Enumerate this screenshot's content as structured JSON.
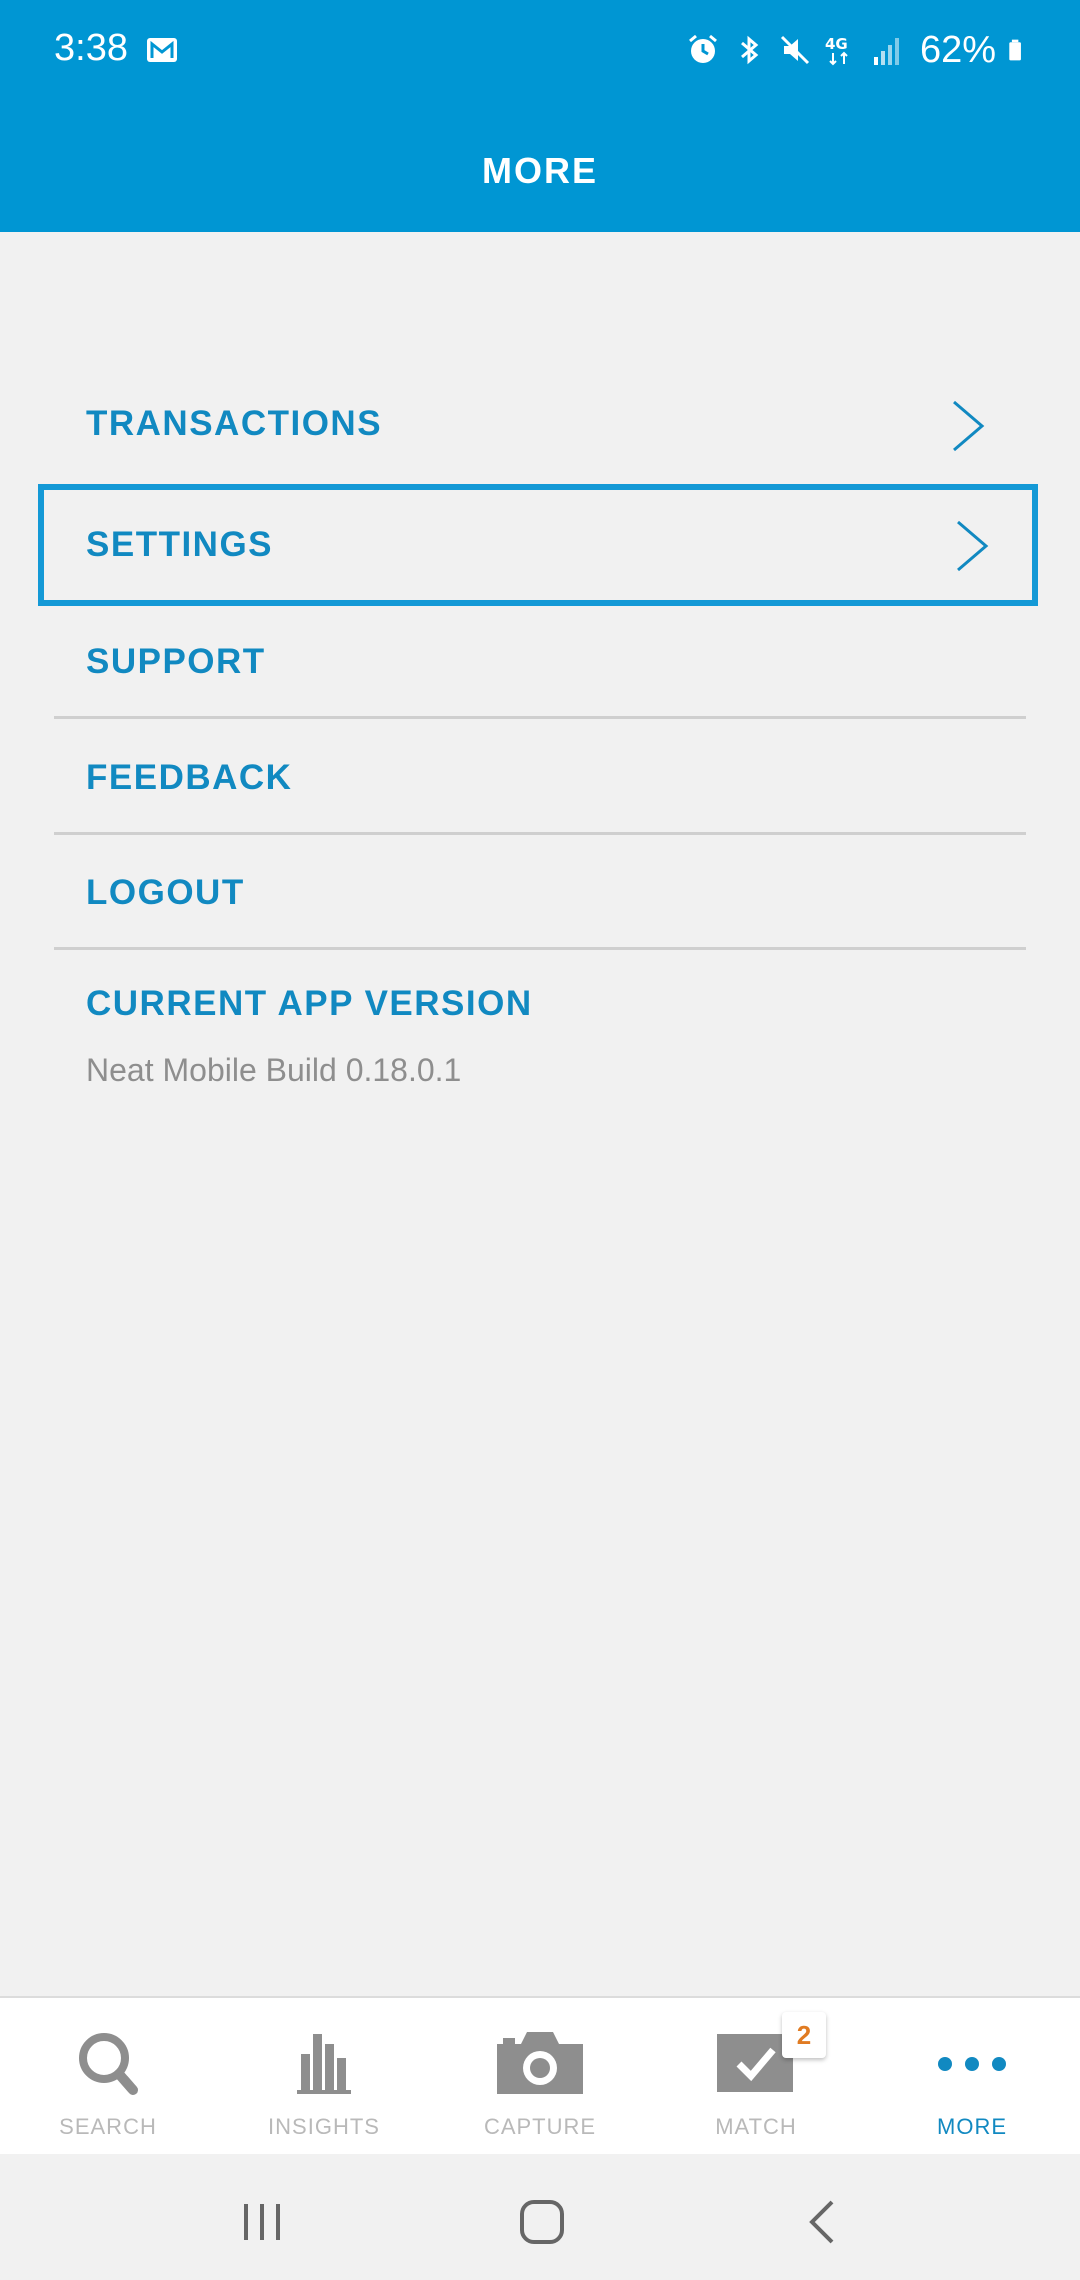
{
  "status_bar": {
    "time": "3:38",
    "battery": "62%",
    "icons": [
      "mail-icon",
      "alarm-icon",
      "bluetooth-icon",
      "mute-icon",
      "4g-icon",
      "signal-icon",
      "battery-icon"
    ]
  },
  "header": {
    "title": "MORE"
  },
  "menu": {
    "transactions": "TRANSACTIONS",
    "settings": "SETTINGS",
    "support": "SUPPORT",
    "feedback": "FEEDBACK",
    "logout": "LOGOUT"
  },
  "version": {
    "title": "CURRENT APP VERSION",
    "value": "Neat Mobile Build 0.18.0.1"
  },
  "bottom_nav": {
    "search": "SEARCH",
    "insights": "INSIGHTS",
    "capture": "CAPTURE",
    "match": "MATCH",
    "match_badge": "2",
    "more": "MORE",
    "active": "more"
  },
  "colors": {
    "accent": "#0096d3",
    "text_link": "#1189c1",
    "badge": "#e07b22"
  }
}
